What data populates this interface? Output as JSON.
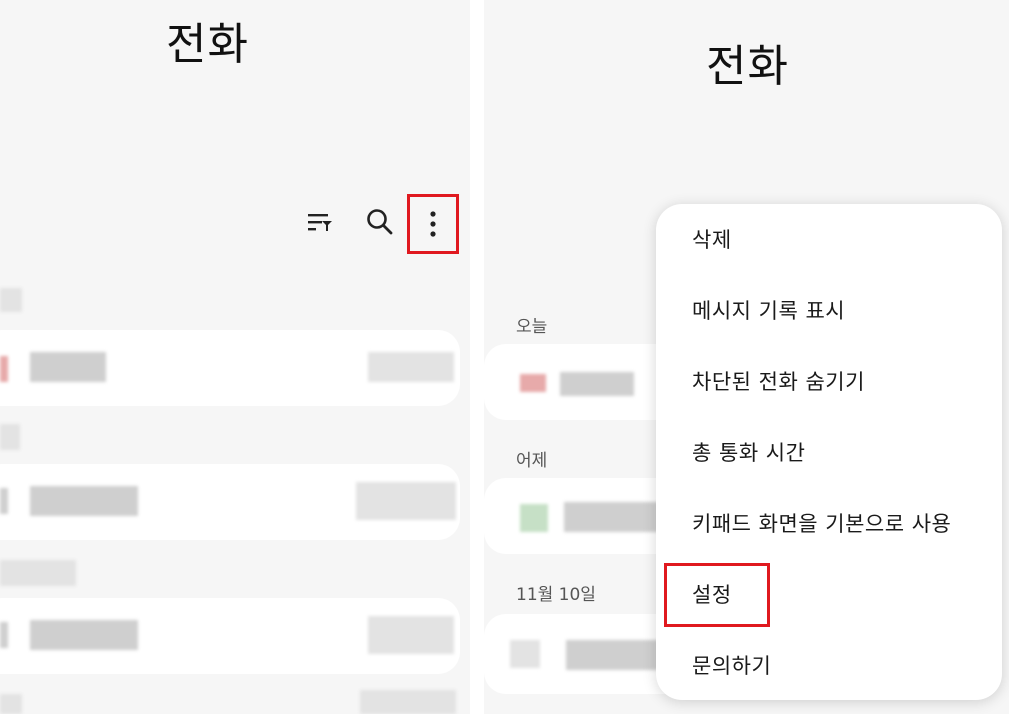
{
  "left": {
    "title": "전화",
    "toolbar": {
      "filter_icon": "filter-sort-icon",
      "search_icon": "search-icon",
      "more_icon": "more-options-icon",
      "highlight_color": "#e0191f"
    }
  },
  "right": {
    "title": "전화",
    "sections": [
      {
        "label": "오늘"
      },
      {
        "label": "어제"
      },
      {
        "label": "11월 10일"
      }
    ],
    "menu": {
      "items": [
        {
          "label": "삭제"
        },
        {
          "label": "메시지 기록 표시"
        },
        {
          "label": "차단된 전화 숨기기"
        },
        {
          "label": "총 통화 시간"
        },
        {
          "label": "키패드 화면을 기본으로 사용"
        },
        {
          "label": "설정",
          "highlighted": true
        },
        {
          "label": "문의하기"
        }
      ]
    }
  }
}
